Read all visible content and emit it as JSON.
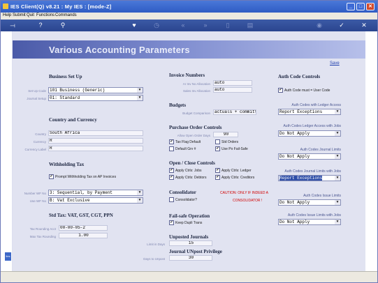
{
  "window": {
    "title": "IES Client(Q) v8.21 : My IES :     [mode-Z]"
  },
  "menu": [
    "Help",
    "Submit",
    "Quit",
    "Functions",
    "Commands"
  ],
  "toolbar_icons": [
    "exit-icon",
    "help-icon",
    "search-icon",
    "heart-icon",
    "clock-icon",
    "rewind-icon",
    "forward-icon",
    "doc-icon",
    "print-icon",
    "lock-icon",
    "check-icon",
    "close-icon"
  ],
  "banner": {
    "title": "Various Accounting Parameters"
  },
  "save_link": "Save",
  "business": {
    "heading": "Business Set Up",
    "setup_code_label": "Set Up Code",
    "setup_code": "101 Business (Generic)",
    "journal_setup_label": "Journal Setup",
    "journal_setup": "01: Standard"
  },
  "country": {
    "heading": "Country and Currency",
    "country_label": "Country",
    "country": "South Africa",
    "currency_label": "Currency",
    "currency": "R",
    "currency_label_label": "Currency Label",
    "currency_label_value": "R"
  },
  "withholding": {
    "heading": "Withholding Tax",
    "prompt_label": "Prompt Withholding Tax on AP Invoices",
    "prompt_checked": true
  },
  "numbering": {
    "number_wf_label": "Number WF No",
    "number_wf": "3: Sequential, by Payment",
    "use_wf_label": "Use WF No",
    "use_wf": "B: Vat Exclusive"
  },
  "std_tax": {
    "heading": "Std Tax: VAT, GST, CGT, PPN",
    "rounding_acct_label": "Tax Rounding Acct",
    "rounding_acct": "00-00-05-2",
    "max_rounding_label": "Max Tax Rounding",
    "max_rounding": "1.00"
  },
  "invoice_numbers": {
    "heading": "Invoice Numbers",
    "ar_label": "Ar Inv No Allocation",
    "ar_value": "auto",
    "sales_label": "Sales Inv Allocation",
    "sales_value": "auto"
  },
  "budgets": {
    "heading": "Budgets",
    "label": "Budget Comparison",
    "value": "actuals + committe"
  },
  "po_controls": {
    "heading": "Purchase Order Controls",
    "allow_open_label": "Allow Open Order Days",
    "allow_open_value": "90",
    "tax_flag": "Tax Flag Default",
    "tax_flag_checked": true,
    "std_orders": "Std Orders",
    "std_orders_checked": false,
    "default_grv": "Default Grv #",
    "default_grv_checked": false,
    "use_po_failsafe": "Use Po Fail-Safe",
    "use_po_failsafe_checked": true
  },
  "open_close": {
    "heading": "Open / Close Controls",
    "apply_jobs": "Apply Ctrls: Jobs",
    "apply_ledger": "Apply Ctrls: Ledger",
    "apply_debtors": "Apply Ctrls: Debtors",
    "apply_creditors": "Apply Ctrls: Creditors"
  },
  "consolidator": {
    "heading": "Consolidator",
    "label": "Consolidator?",
    "checked": false,
    "warning_line1": "CAUTION: ONLY IF INDEED A",
    "warning_line2": "CONSOLIDATOR !"
  },
  "failsafe": {
    "heading": "Fail-safe Operation",
    "keep_dupli": "Keep Dupli Trans",
    "checked": true
  },
  "unposted": {
    "heading": "Unposted Journals",
    "label": "Limit in Days",
    "value": "15"
  },
  "unpost_priv": {
    "heading": "Journal UNpost Privilege",
    "label": "Days to Unpost",
    "value": "30"
  },
  "auth": {
    "heading": "Auth Code Controls",
    "must_user": "Auth Code must = User Code",
    "must_user_checked": true,
    "ledger_access_label": "Auth Codes with Ledger Access",
    "ledger_access": "Report Exceptions",
    "ledger_jobs_label": "Auth Codes Ledger Access with Jobs",
    "ledger_jobs": "Do Not Apply",
    "journal_limits_label": "Auth Codes Journal Limits",
    "journal_limits": "Do Not Apply",
    "journal_limits_jobs_label": "Auth Codes Journal Limits with Jobs",
    "journal_limits_jobs": "Report Exceptions",
    "issue_limits_label": "Auth Codes Issue Limits",
    "issue_limits": "Do Not Apply",
    "issue_limits_jobs_label": "Auth Codes Issue Limits with Jobs",
    "issue_limits_jobs": "Do Not Apply"
  }
}
